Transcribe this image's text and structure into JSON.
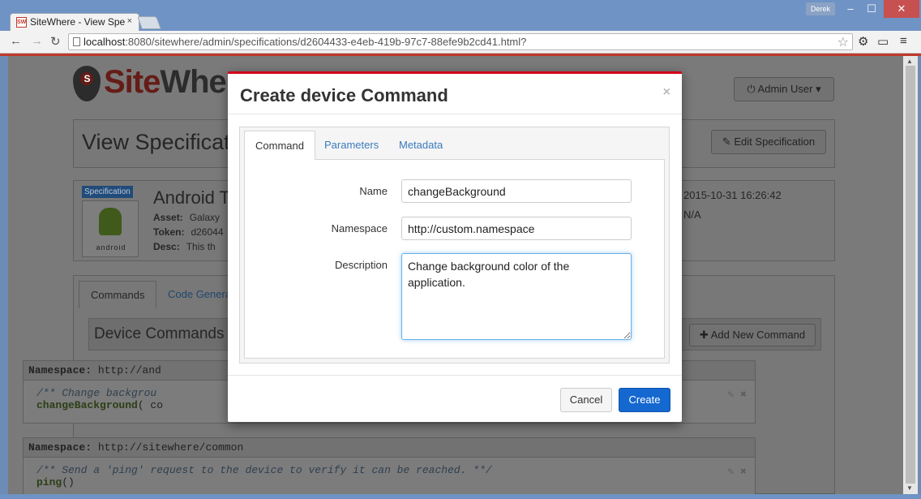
{
  "browser": {
    "tab_title": "SiteWhere - View Spe",
    "tab_close": "×",
    "user_name": "Derek",
    "url_host": "localhost",
    "url_rest": ":8080/sitewhere/admin/specifications/d2604433-e4eb-419b-97c7-88efe9b2cd41.html?",
    "win_min": "‒",
    "win_max": "☐",
    "win_close": "✕"
  },
  "header": {
    "logo_red": "Site",
    "logo_black": "Where",
    "admin_button": "⏻ Admin User ▾"
  },
  "spec_header": {
    "title": "View Specificat",
    "edit_button": "✎ Edit Specification"
  },
  "spec_info": {
    "badge": "Specification",
    "logo_text": "android",
    "name": "Android T",
    "asset_label": "Asset:",
    "asset_value": "Galaxy",
    "token_label": "Token:",
    "token_value": "d26044",
    "desc_label": "Desc:",
    "desc_value": "This th",
    "date": "2015-10-31 16:26:42",
    "na": "N/A"
  },
  "page_tabs": {
    "commands": "Commands",
    "code_gen": "Code Genera"
  },
  "commands": {
    "title": "Device Commands",
    "add_button": "✚ Add New Command",
    "blocks": [
      {
        "ns_label": "Namespace:",
        "ns_value": "http://and",
        "comment": "/** Change backgrou",
        "fn_name": "changeBackground",
        "fn_args": "( co"
      },
      {
        "ns_label": "Namespace:",
        "ns_value": "http://sitewhere/common",
        "comment": "/** Send a 'ping' request to the device to verify it can be reached. **/",
        "fn_name": "ping",
        "fn_args": "()"
      }
    ]
  },
  "modal": {
    "title": "Create device Command",
    "close": "×",
    "tabs": [
      "Command",
      "Parameters",
      "Metadata"
    ],
    "fields": {
      "name_label": "Name",
      "name_value": "changeBackground",
      "namespace_label": "Namespace",
      "namespace_value": "http://custom.namespace",
      "description_label": "Description",
      "description_value": "Change background color of the application."
    },
    "cancel": "Cancel",
    "create": "Create"
  }
}
